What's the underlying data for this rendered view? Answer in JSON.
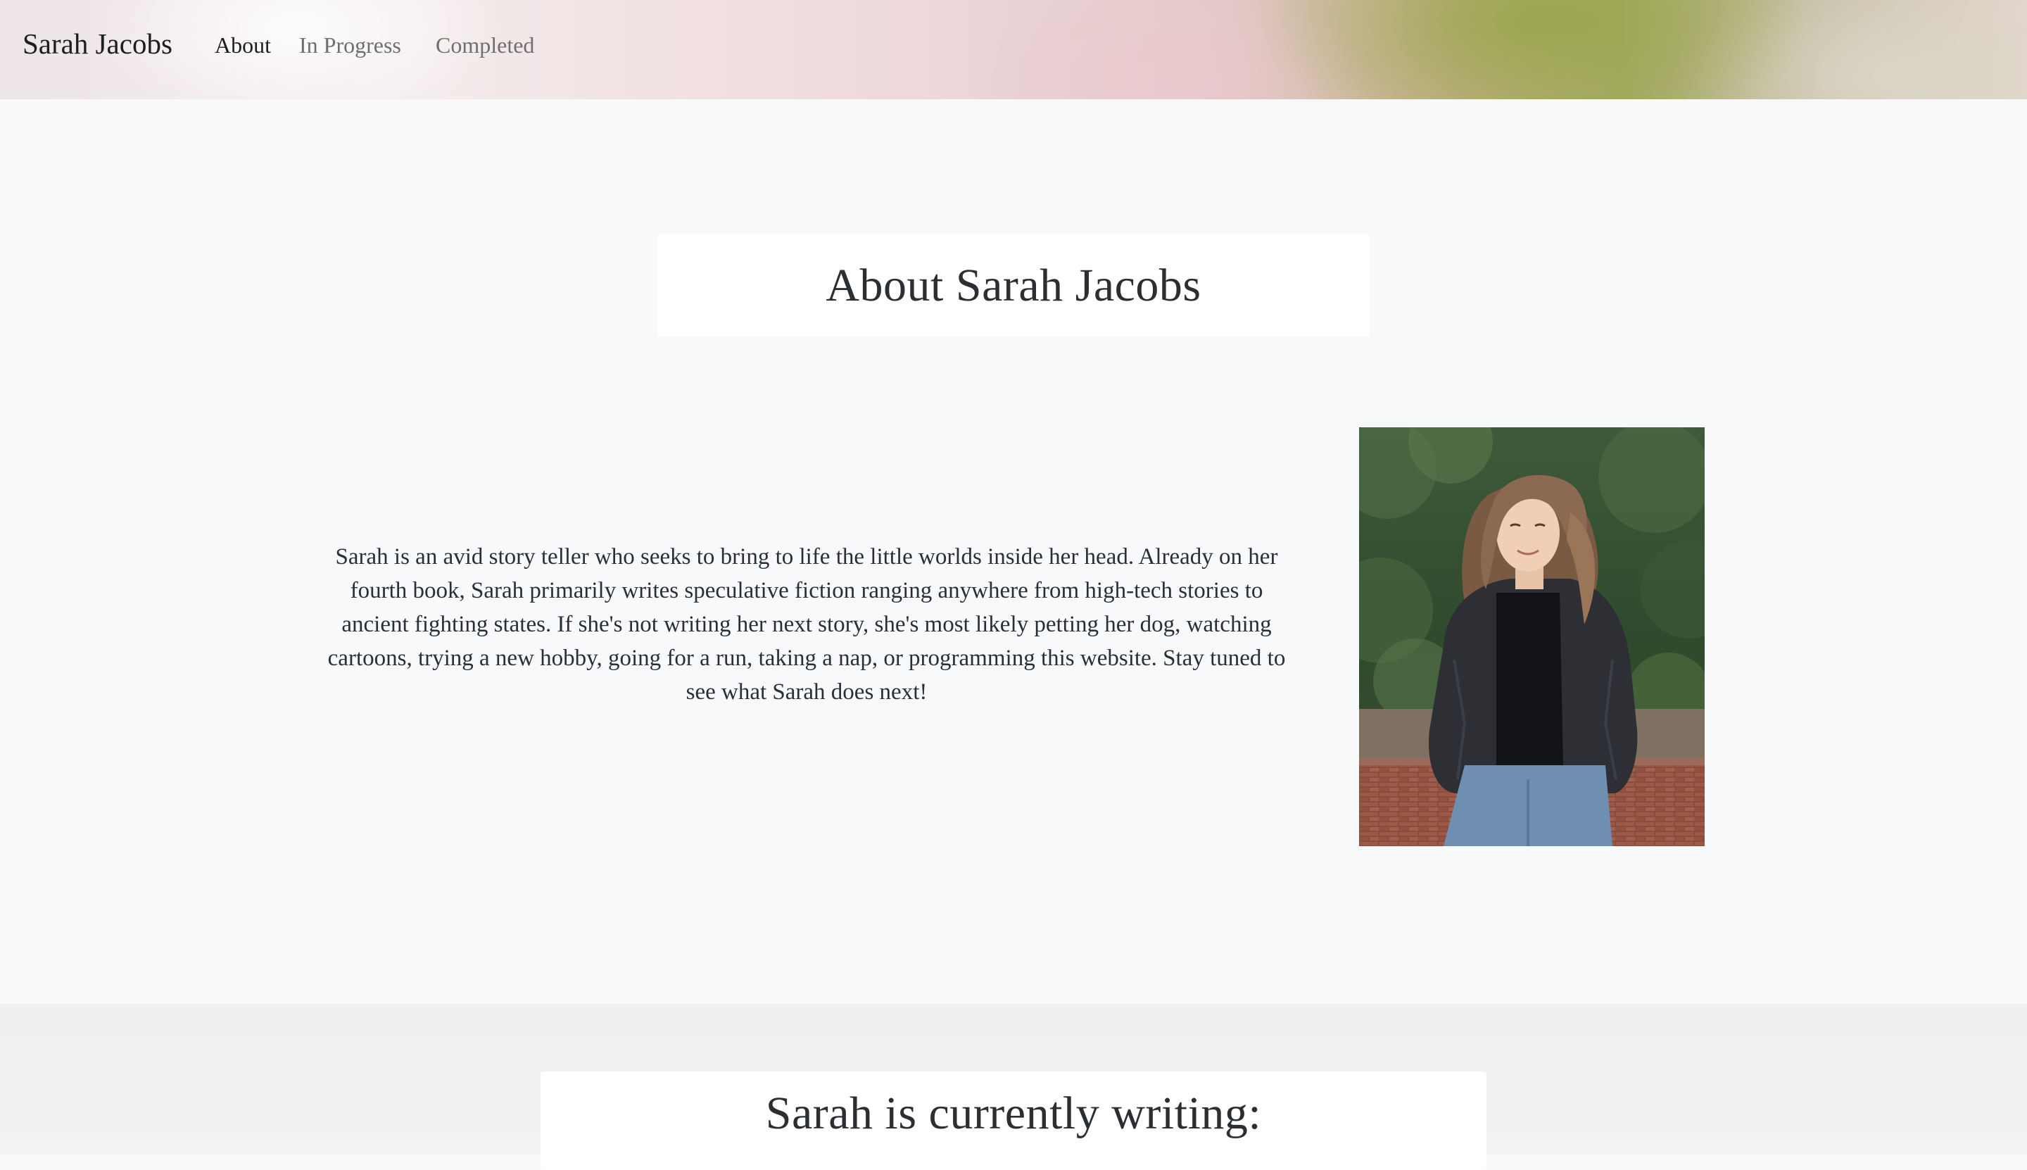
{
  "navbar": {
    "brand": "Sarah Jacobs",
    "links": [
      {
        "label": "About",
        "active": true
      },
      {
        "label": "In Progress",
        "active": false
      },
      {
        "label": "Completed",
        "active": false
      }
    ]
  },
  "about": {
    "title": "About Sarah Jacobs",
    "bio": "Sarah is an avid story teller who seeks to bring to life the little worlds inside her head. Already on her fourth book, Sarah primarily writes speculative fiction ranging anywhere from high-tech stories to ancient fighting states. If she's not writing her next story, she's most likely petting her dog, watching cartoons, trying a new hobby, going for a run, taking a nap, or programming this website. Stay tuned to see what Sarah does next!"
  },
  "writing": {
    "title": "Sarah is currently writing:"
  },
  "colors": {
    "page_background": "#f8f9fa",
    "card_background": "#ffffff",
    "text": "#2b2f33",
    "nav_muted": "#6c6f73"
  }
}
